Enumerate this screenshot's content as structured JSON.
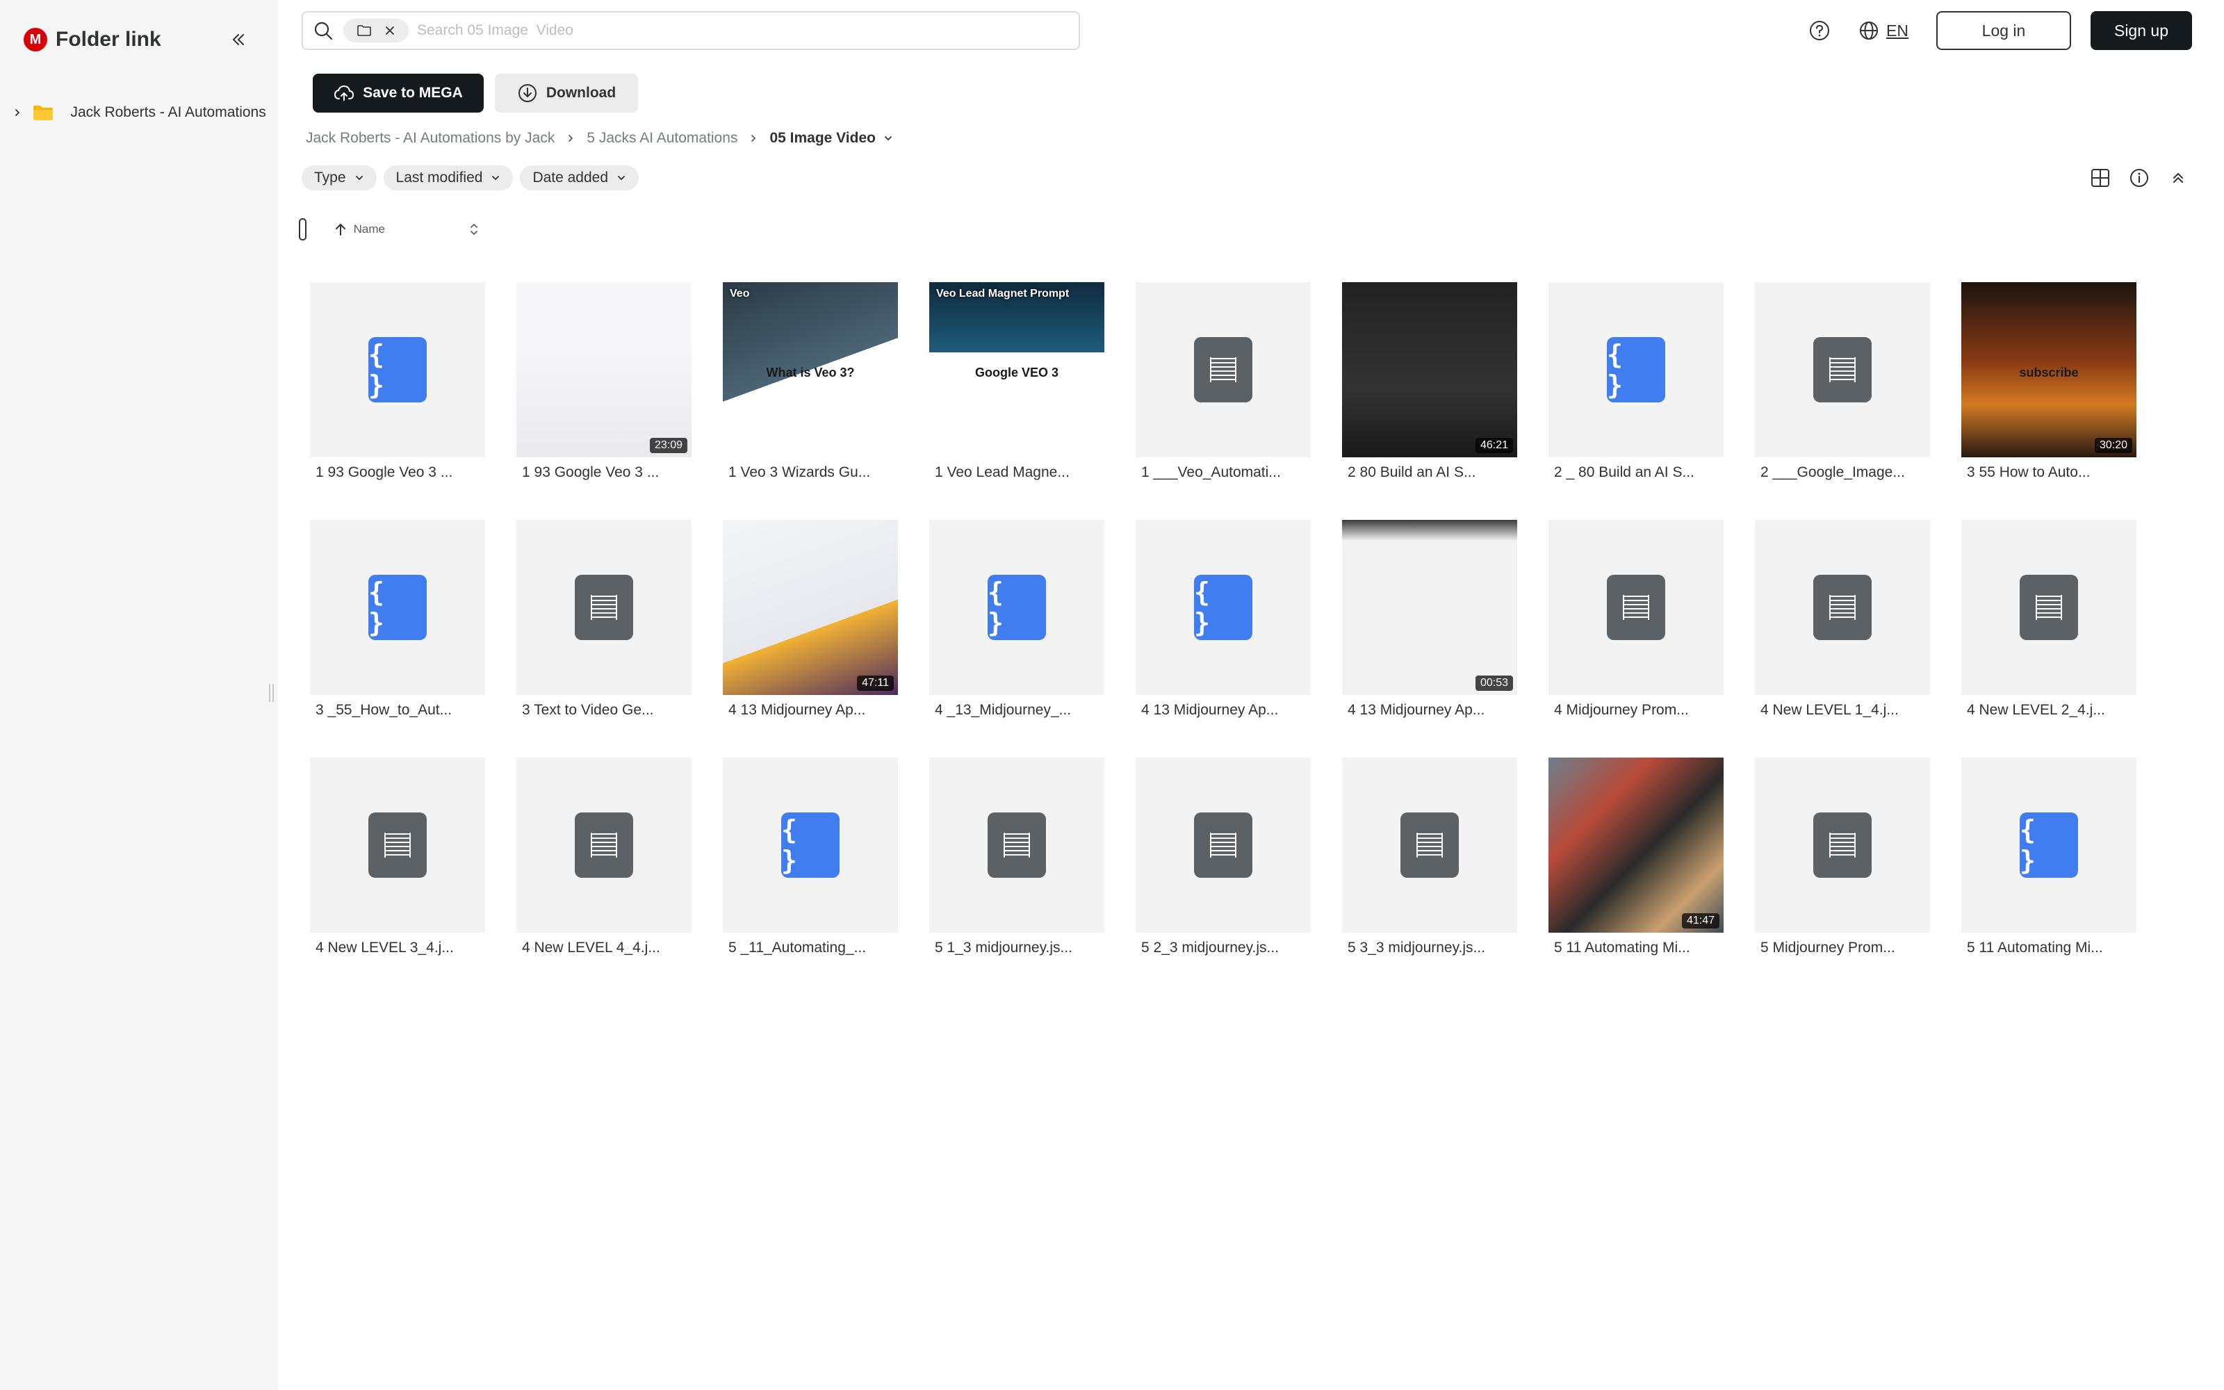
{
  "app": {
    "logo_letter": "M",
    "title": "Folder link"
  },
  "sidebar": {
    "tree": [
      {
        "label": "Jack Roberts - AI Automations by Jack"
      }
    ]
  },
  "search": {
    "placeholder": "Search 05 Image  Video"
  },
  "header": {
    "language": "EN",
    "login_label": "Log in",
    "signup_label": "Sign up"
  },
  "toolbar": {
    "save_label": "Save to MEGA",
    "download_label": "Download"
  },
  "breadcrumb": {
    "items": [
      "Jack Roberts - AI Automations by Jack",
      "5 Jacks AI Automations"
    ],
    "current": "05 Image Video"
  },
  "filters": [
    "Type",
    "Last modified",
    "Date added"
  ],
  "sort": {
    "label": "Name"
  },
  "colors": {
    "accent": "#d90007",
    "code_file": "#3f7df0",
    "text_file": "#5c6166",
    "primary_button": "#151a1f"
  },
  "files": [
    {
      "name": "1 93 Google Veo 3 ...",
      "kind": "code"
    },
    {
      "name": "1 93 Google Veo 3 ...",
      "kind": "video",
      "duration": "23:09"
    },
    {
      "name": "1 Veo 3 Wizards Gu...",
      "kind": "image",
      "overlay": "Veo",
      "caption": "What is Veo 3?"
    },
    {
      "name": "1 Veo Lead Magne...",
      "kind": "image",
      "overlay": "Veo Lead Magnet Prompt",
      "caption": "Google VEO 3"
    },
    {
      "name": "1 ___Veo_Automati...",
      "kind": "text"
    },
    {
      "name": "2  80 Build an AI S...",
      "kind": "video",
      "duration": "46:21"
    },
    {
      "name": "2 _ 80 Build an AI S...",
      "kind": "code"
    },
    {
      "name": "2 ___Google_Image...",
      "kind": "text"
    },
    {
      "name": "3 55 How to Auto...",
      "kind": "video",
      "duration": "30:20",
      "caption": "subscribe"
    },
    {
      "name": "3 _55_How_to_Aut...",
      "kind": "code"
    },
    {
      "name": "3 Text to Video Ge...",
      "kind": "text"
    },
    {
      "name": "4 13 Midjourney Ap...",
      "kind": "video",
      "duration": "47:11"
    },
    {
      "name": "4 _13_Midjourney_...",
      "kind": "code"
    },
    {
      "name": "4 13 Midjourney Ap...",
      "kind": "code"
    },
    {
      "name": "4 13 Midjourney Ap...",
      "kind": "video",
      "duration": "00:53"
    },
    {
      "name": "4 Midjourney Prom...",
      "kind": "text"
    },
    {
      "name": "4 New LEVEL 1_4.j...",
      "kind": "text"
    },
    {
      "name": "4 New LEVEL 2_4.j...",
      "kind": "text"
    },
    {
      "name": "4 New LEVEL 3_4.j...",
      "kind": "text"
    },
    {
      "name": "4 New LEVEL 4_4.j...",
      "kind": "text"
    },
    {
      "name": "5 _11_Automating_...",
      "kind": "code"
    },
    {
      "name": "5 1_3 midjourney.js...",
      "kind": "text"
    },
    {
      "name": "5 2_3 midjourney.js...",
      "kind": "text"
    },
    {
      "name": "5 3_3 midjourney.js...",
      "kind": "text"
    },
    {
      "name": "5 11 Automating Mi...",
      "kind": "video",
      "duration": "41:47"
    },
    {
      "name": "5 Midjourney Prom...",
      "kind": "text"
    },
    {
      "name": "5 11 Automating Mi...",
      "kind": "code"
    }
  ]
}
